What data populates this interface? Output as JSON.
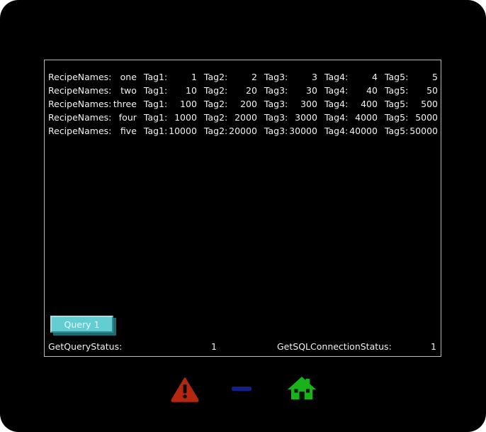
{
  "screen": {
    "background_color": "#000000",
    "panel_border_color": "#b9b9b9"
  },
  "recipe_table": {
    "label_text": "RecipeNames:",
    "tag_labels": [
      "Tag1:",
      "Tag2:",
      "Tag3:",
      "Tag4:",
      "Tag5:"
    ],
    "rows": [
      {
        "name": "one",
        "values": [
          "1",
          "2",
          "3",
          "4",
          "5"
        ]
      },
      {
        "name": "two",
        "values": [
          "10",
          "20",
          "30",
          "40",
          "50"
        ]
      },
      {
        "name": "three",
        "values": [
          "100",
          "200",
          "300",
          "400",
          "500"
        ]
      },
      {
        "name": "four",
        "values": [
          "1000",
          "2000",
          "3000",
          "4000",
          "5000"
        ]
      },
      {
        "name": "five",
        "values": [
          "10000",
          "20000",
          "30000",
          "40000",
          "50000"
        ]
      }
    ]
  },
  "query_button": {
    "label": "Query 1",
    "fill_color": "#63cdd1",
    "highlight_color": "#9fe3e6",
    "shadow_color": "#1e6a70"
  },
  "status_bar": {
    "query_status_label": "GetQueryStatus:",
    "query_status_value": "1",
    "sql_connection_label": "GetSQLConnectionStatus:",
    "sql_connection_value": "1"
  },
  "icon_bar": {
    "items": [
      {
        "name": "alarm-warning-icon",
        "color": "#b5270f"
      },
      {
        "name": "minimize-icon",
        "color": "#10208c"
      },
      {
        "name": "home-icon",
        "color": "#18b318"
      }
    ]
  }
}
